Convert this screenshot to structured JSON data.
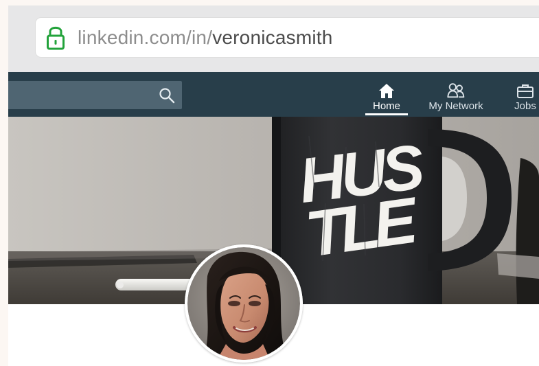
{
  "browser": {
    "url_domain": "linkedin.com/in/",
    "url_path": "veronicasmith"
  },
  "nav": {
    "search_placeholder": "",
    "items": [
      {
        "label": "Home",
        "icon": "home-icon",
        "active": true
      },
      {
        "label": "My Network",
        "icon": "network-icon",
        "active": false
      },
      {
        "label": "Jobs",
        "icon": "briefcase-icon",
        "active": false
      }
    ]
  },
  "cover": {
    "mug_text_line1": "HUS",
    "mug_text_line2": "TLE"
  },
  "colors": {
    "linkedin_nav": "#283e4a",
    "search_box": "#4f6572",
    "secure_lock": "#23a33b",
    "url_domain": "#8d8d8d",
    "url_path": "#4b4b4b"
  }
}
